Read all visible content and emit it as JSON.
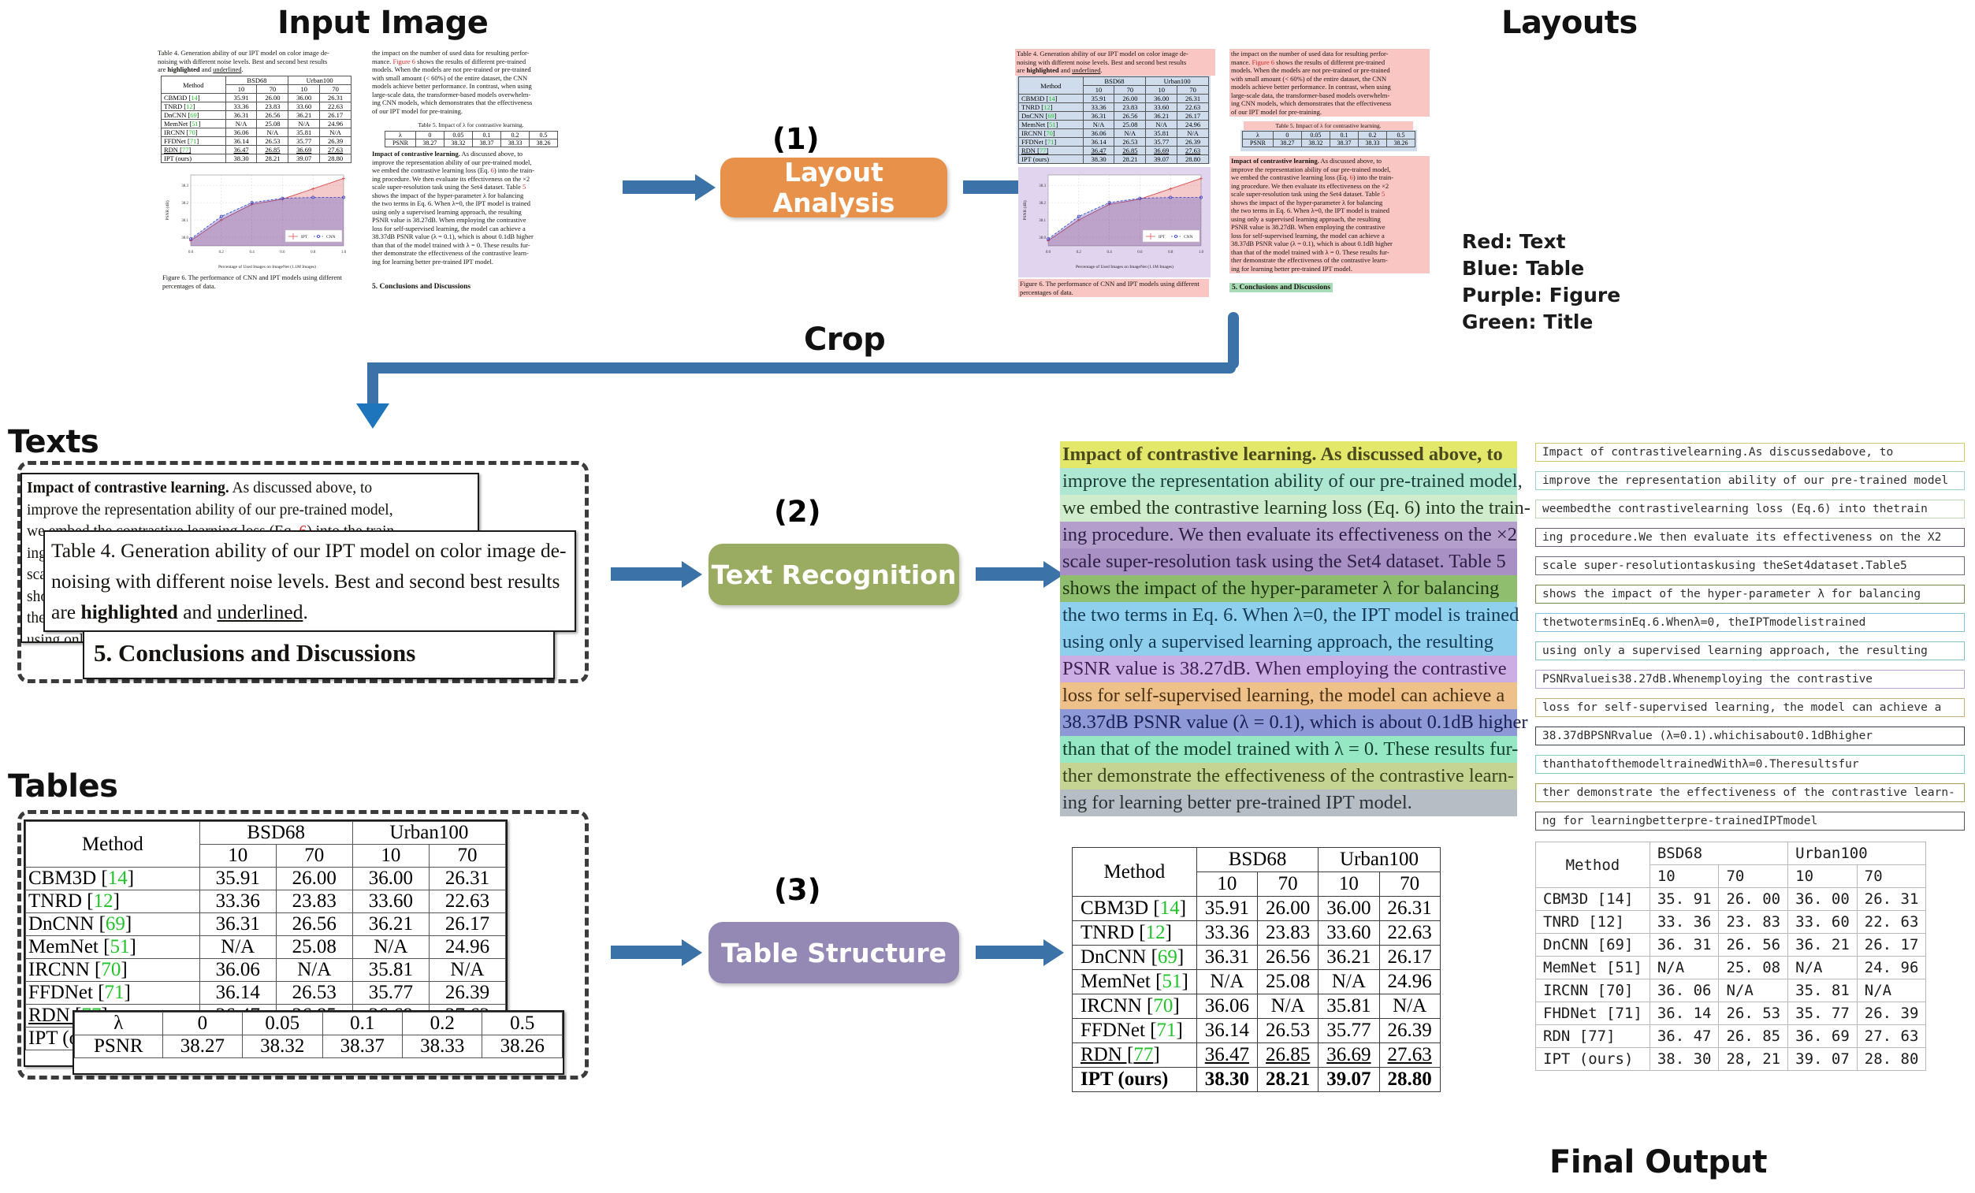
{
  "headings": {
    "input_image": "Input Image",
    "layouts": "Layouts",
    "texts": "Texts",
    "tables": "Tables",
    "final_output": "Final Output",
    "crop": "Crop"
  },
  "steps": [
    {
      "num": "(1)",
      "label": "Layout Analysis",
      "color": "#e8914a"
    },
    {
      "num": "(2)",
      "label": "Text Recognition",
      "color": "#9aab62"
    },
    {
      "num": "(3)",
      "label": "Table Structure",
      "color": "#9489b4"
    }
  ],
  "legend": {
    "items": [
      {
        "text": "Red: Text",
        "color": "#f9c6c4"
      },
      {
        "text": "Blue: Table",
        "color": "#cfdcec"
      },
      {
        "text": "Purple: Figure",
        "color": "#e0d4ef"
      },
      {
        "text": "Green: Title",
        "color": "#a8dcb6"
      }
    ]
  },
  "paper": {
    "table4_caption_lines": [
      "Table 4. Generation ability of our IPT model on color image de-",
      "noising with different noise levels.  Best and second best results",
      "are highlighted and underlined."
    ],
    "table4_caption_plain": "Table 4. Generation ability of our IPT model on color image denoising with different noise levels. Best and second best results are highlighted and underlined.",
    "right_col_paragraph": "the impact on the number of used data for resulting perfor-mance. Figure 6 shows the results of different pre-trained models. When the models are not pre-trained or pre-trained with small amount (< 60%) of the entire dataset, the CNN models achieve better performance. In contrast, when using large-scale data, the transformer-based models overwhelm-ing CNN models, which demonstrates that the effectiveness of our IPT model for pre-training.",
    "right_col_lines": [
      "the impact on the number of used data for resulting perfor-",
      "mance.  Figure 6 shows the results of different pre-trained",
      "models. When the models are not pre-trained or pre-trained",
      "with small amount (< 60%) of the entire dataset, the CNN",
      "models achieve better performance. In contrast, when using",
      "large-scale data, the transformer-based models overwhelm-",
      "ing CNN models, which demonstrates that the effectiveness",
      "of our IPT model for pre-training."
    ],
    "table5_caption": "Table 5. Impact of λ for contrastive learning.",
    "contrastive_lines": [
      "Impact of contrastive learning. As discussed above, to",
      "improve the representation ability of our pre-trained model,",
      "we embed the contrastive learning loss (Eq. 6) into the train-",
      "ing procedure. We then evaluate its effectiveness on the ×2",
      "scale super-resolution task using the Set4 dataset.  Table 5",
      "shows the impact of the hyper-parameter λ for balancing",
      "the two terms in Eq. 6. When λ=0, the IPT model is trained",
      "using only a supervised learning approach, the resulting",
      "PSNR value is 38.27dB. When employing the contrastive",
      "loss for self-supervised learning, the model can achieve a",
      "38.37dB PSNR value (λ = 0.1), which is about 0.1dB higher",
      "than that of the model trained with λ = 0. These results fur-",
      "ther demonstrate the effectiveness of the contrastive learn-",
      "ing for learning better pre-trained IPT model."
    ],
    "section_title": "5. Conclusions and Discussions",
    "figure_caption_lines": [
      "Figure 6. The performance of CNN and IPT models using different",
      "percentages of data."
    ]
  },
  "chart_data": {
    "type": "line",
    "title": "",
    "xlabel": "Percentage of Used Images on ImageNet (1.1M Images)",
    "ylabel": "PSNR (dB)",
    "x": [
      0.0,
      0.2,
      0.4,
      0.6,
      0.8,
      1.0
    ],
    "xticks": [
      "0.0",
      "0.2",
      "0.4",
      "0.6",
      "0.8",
      "1.0"
    ],
    "yticks": [
      "38.0",
      "38.1",
      "38.2",
      "38.3"
    ],
    "ylim": [
      37.95,
      38.36
    ],
    "xlim": [
      0.0,
      1.0
    ],
    "grid": true,
    "legend_position": "lower-right",
    "series": [
      {
        "name": "IPT",
        "color": "#d94f4f",
        "style": "solid-marker-plus",
        "values": [
          37.98,
          38.1,
          38.19,
          38.22,
          38.28,
          38.34
        ]
      },
      {
        "name": "CNN",
        "color": "#4048c8",
        "style": "dashed-marker-circle",
        "values": [
          37.99,
          38.12,
          38.2,
          38.225,
          38.23,
          38.23
        ]
      }
    ]
  },
  "table4": {
    "col_method": "Method",
    "groups": [
      "BSD68",
      "Urban100"
    ],
    "sub_headers": [
      "10",
      "70",
      "10",
      "70"
    ],
    "rows": [
      {
        "method": "CBM3D",
        "ref": "14",
        "vals": [
          "35.91",
          "26.00",
          "36.00",
          "26.31"
        ],
        "style": "normal"
      },
      {
        "method": "TNRD",
        "ref": "12",
        "vals": [
          "33.36",
          "23.83",
          "33.60",
          "22.63"
        ],
        "style": "normal"
      },
      {
        "method": "DnCNN",
        "ref": "69",
        "vals": [
          "36.31",
          "26.56",
          "36.21",
          "26.17"
        ],
        "style": "normal"
      },
      {
        "method": "MemNet",
        "ref": "51",
        "vals": [
          "N/A",
          "25.08",
          "N/A",
          "24.96"
        ],
        "style": "normal"
      },
      {
        "method": "IRCNN",
        "ref": "70",
        "vals": [
          "36.06",
          "N/A",
          "35.81",
          "N/A"
        ],
        "style": "normal"
      },
      {
        "method": "FFDNet",
        "ref": "71",
        "vals": [
          "36.14",
          "26.53",
          "35.77",
          "26.39"
        ],
        "style": "normal"
      },
      {
        "method": "RDN",
        "ref": "77",
        "vals": [
          "36.47",
          "26.85",
          "36.69",
          "27.63"
        ],
        "style": "underline"
      },
      {
        "method": "IPT (ours)",
        "ref": "",
        "vals": [
          "38.30",
          "28.21",
          "39.07",
          "28.80"
        ],
        "style": "bold"
      }
    ]
  },
  "table4_final_ocr": {
    "col_method": "Method",
    "groups": [
      "BSD68",
      "Urban100"
    ],
    "sub_headers": [
      "10",
      "70",
      "10",
      "70"
    ],
    "rows": [
      {
        "method": "CBM3D [14]",
        "vals": [
          "35. 91",
          "26. 00",
          "36. 00",
          "26. 31"
        ]
      },
      {
        "method": "TNRD [12]",
        "vals": [
          "33. 36",
          "23. 83",
          "33. 60",
          "22. 63"
        ]
      },
      {
        "method": "DnCNN [69]",
        "vals": [
          "36. 31",
          "26. 56",
          "36. 21",
          "26. 17"
        ]
      },
      {
        "method": "MemNet [51]",
        "vals": [
          "N/A",
          "25. 08",
          "N/A",
          "24. 96"
        ]
      },
      {
        "method": "IRCNN [70]",
        "vals": [
          "36. 06",
          "N/A",
          "35. 81",
          "N/A"
        ]
      },
      {
        "method": "FHDNet [71]",
        "vals": [
          "36. 14",
          "26. 53",
          "35. 77",
          "26. 39"
        ]
      },
      {
        "method": "RDN [77]",
        "vals": [
          "36. 47",
          "26. 85",
          "36. 69",
          "27. 63"
        ]
      },
      {
        "method": "IPT (ours)",
        "vals": [
          "38. 30",
          "28, 21",
          "39. 07",
          "28. 80"
        ]
      }
    ]
  },
  "table5": {
    "row_labels": [
      "λ",
      "PSNR"
    ],
    "lambda_values": [
      "0",
      "0.05",
      "0.1",
      "0.2",
      "0.5"
    ],
    "psnr_values": [
      "38.27",
      "38.32",
      "38.37",
      "38.33",
      "38.26"
    ]
  },
  "text_crops": {
    "paragraph_snippet_lines": [
      "Impact of contrastive learning. As discussed above, to",
      "improve the representation ability of our pre-trained model,",
      "we embed the contrastive learning loss (Eq. 6) into the train-"
    ],
    "table_caption_snippet": "Table 4. Generation ability of our IPT model on color image denoising with different noise levels.  Best and second best results are highlighted and underlined.",
    "title_snippet": "5. Conclusions and Discussions"
  },
  "recognized_lines": [
    {
      "text": "Impact of contrastive learning. As discussed above, to",
      "bg": "#e4e86a",
      "fg": "#4a4a1f",
      "bold_prefix": "Impact of contrastive learning."
    },
    {
      "text": "improve the representation ability of our pre-trained model,",
      "bg": "#aee7d2",
      "fg": "#1c3d39",
      "bold_prefix": ""
    },
    {
      "text": "we embed the contrastive learning loss (Eq. 6) into the train-",
      "bg": "#cfeccd",
      "fg": "#24381f",
      "bold_prefix": ""
    },
    {
      "text": "ing procedure. We then evaluate its effectiveness on the ×2",
      "bg": "#b49fcc",
      "fg": "#2b1f42",
      "bold_prefix": ""
    },
    {
      "text": "scale super-resolution task using the Set4 dataset.  Table 5",
      "bg": "#a88fc4",
      "fg": "#2b1f42",
      "bold_prefix": ""
    },
    {
      "text": "shows the impact of the hyper-parameter λ for balancing",
      "bg": "#8fbf6e",
      "fg": "#1e3313",
      "bold_prefix": ""
    },
    {
      "text": "the two terms in Eq. 6. When λ=0, the IPT model is trained",
      "bg": "#8fd0ee",
      "fg": "#153a52",
      "bold_prefix": ""
    },
    {
      "text": "using only a supervised learning approach, the resulting",
      "bg": "#8fcfed",
      "fg": "#153a52",
      "bold_prefix": ""
    },
    {
      "text": "PSNR value is 38.27dB. When employing the contrastive",
      "bg": "#cdaee4",
      "fg": "#3a2150",
      "bold_prefix": ""
    },
    {
      "text": "loss for self-supervised learning, the model can achieve a",
      "bg": "#eec08a",
      "fg": "#4a3113",
      "bold_prefix": ""
    },
    {
      "text": "38.37dB PSNR value (λ = 0.1), which is about 0.1dB higher",
      "bg": "#8e99d8",
      "fg": "#1b2050",
      "bold_prefix": ""
    },
    {
      "text": "than that of the model trained with λ = 0. These results fur-",
      "bg": "#96e8c4",
      "fg": "#14402f",
      "bold_prefix": ""
    },
    {
      "text": "ther demonstrate the effectiveness of the contrastive learn-",
      "bg": "#c5d493",
      "fg": "#3a431c",
      "bold_prefix": ""
    },
    {
      "text": "ing for learning better pre-trained IPT model.",
      "bg": "#b6bdc4",
      "fg": "#2b3238",
      "bold_prefix": ""
    }
  ],
  "ocr_output_lines": [
    {
      "text": "Impact of contrastivelearning.As discussedabove, to",
      "border": "#cfc96b"
    },
    {
      "text": "improve the representation ability of our pre-trained model",
      "border": "#9ed4c4"
    },
    {
      "text": "weembedthe contrastivelearning loss (Eq.6) into thetrain",
      "border": "#bcd6b4"
    },
    {
      "text": "ing procedure.We then evaluate its effectiveness on the X2",
      "border": "#6a5a7a"
    },
    {
      "text": "scale super-resolutiontaskusing theSet4dataset.Table5",
      "border": "#6d6a82"
    },
    {
      "text": "shows the impact of the hyper-parameter λ for balancing",
      "border": "#6e8a4e"
    },
    {
      "text": "thetwotermsinEq.6.Whenλ=0, theIPTmodelistrained",
      "border": "#7fc3dd"
    },
    {
      "text": "using only a supervised learning approach, the resulting",
      "border": "#7fc3c9"
    },
    {
      "text": "PSNRvalueis38.27dB.Whenemploying the contrastive",
      "border": "#b8a2cd"
    },
    {
      "text": "loss for self-supervised learning,  the model can achieve a",
      "border": "#c7b277"
    },
    {
      "text": "38.37dBPSNRvalue (λ=0.1).whichisabout0.1dBhigher",
      "border": "#3b3f55"
    },
    {
      "text": "thanthatofthemodeltrainedWithλ=0.Theresultsfur",
      "border": "#7fd0bb"
    },
    {
      "text": "ther demonstrate the effectiveness of the contrastive learn-",
      "border": "#a89b56"
    },
    {
      "text": "ng for learningbetterpre-trainedIPTmodel",
      "border": "#555555"
    }
  ],
  "chart_legend": {
    "ipt": "IPT",
    "cnn": "CNN"
  }
}
